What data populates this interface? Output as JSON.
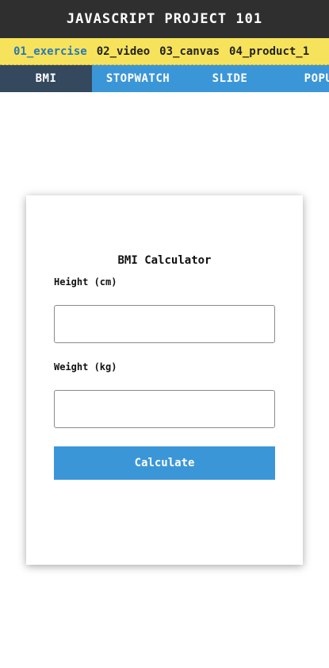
{
  "header": {
    "title": "JAVASCRIPT PROJECT 101"
  },
  "projects": {
    "items": [
      {
        "label": "01_exercise",
        "active": true
      },
      {
        "label": "02_video",
        "active": false
      },
      {
        "label": "03_canvas",
        "active": false
      },
      {
        "label": "04_product_1",
        "active": false
      }
    ]
  },
  "tabs": {
    "items": [
      {
        "label": "BMI",
        "active": true
      },
      {
        "label": "STOPWATCH",
        "active": false
      },
      {
        "label": "SLIDE",
        "active": false
      },
      {
        "label": "POPUP",
        "active": false
      }
    ]
  },
  "calculator": {
    "title": "BMI Calculator",
    "height_label": "Height (cm)",
    "height_value": "",
    "weight_label": "Weight (kg)",
    "weight_value": "",
    "button_label": "Calculate"
  },
  "colors": {
    "title_bar": "#2f2f2f",
    "project_bar": "#f7e35b",
    "project_active": "#2a77b6",
    "tab_bar": "#3b96d8",
    "tab_active": "#34485e",
    "button": "#3b96d8"
  }
}
